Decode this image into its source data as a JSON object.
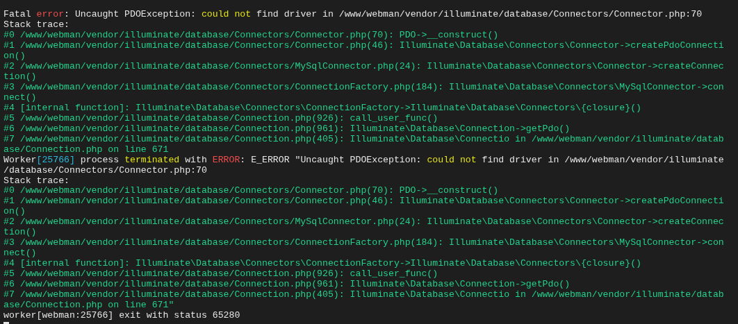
{
  "terminal": {
    "lines": [
      [
        {
          "text": "Fatal ",
          "color": "#e6e6e6"
        },
        {
          "text": "error",
          "color": "#f14c4c"
        },
        {
          "text": ": Uncaught PDOException: ",
          "color": "#e6e6e6"
        },
        {
          "text": "could not",
          "color": "#e5e510"
        },
        {
          "text": " find driver in /www/webman/vendor/illuminate/database/Connectors/Connector.php:70",
          "color": "#e6e6e6"
        }
      ],
      [
        {
          "text": "Stack trace:",
          "color": "#e6e6e6"
        }
      ],
      [
        {
          "text": "#0 /www/webman/vendor/illuminate/database/Connectors/Connector.php(70): PDO->__construct()",
          "color": "#23d18b"
        }
      ],
      [
        {
          "text": "#1 /www/webman/vendor/illuminate/database/Connectors/Connector.php(46): Illuminate\\Database\\Connectors\\Connector->createPdoConnecti",
          "color": "#23d18b"
        }
      ],
      [
        {
          "text": "on()",
          "color": "#23d18b"
        }
      ],
      [
        {
          "text": "#2 /www/webman/vendor/illuminate/database/Connectors/MySqlConnector.php(24): Illuminate\\Database\\Connectors\\Connector->createConnec",
          "color": "#23d18b"
        }
      ],
      [
        {
          "text": "tion()",
          "color": "#23d18b"
        }
      ],
      [
        {
          "text": "#3 /www/webman/vendor/illuminate/database/Connectors/ConnectionFactory.php(184): Illuminate\\Database\\Connectors\\MySqlConnector->con",
          "color": "#23d18b"
        }
      ],
      [
        {
          "text": "nect()",
          "color": "#23d18b"
        }
      ],
      [
        {
          "text": "#4 [internal function]: Illuminate\\Database\\Connectors\\ConnectionFactory->Illuminate\\Database\\Connectors\\{closure}()",
          "color": "#23d18b"
        }
      ],
      [
        {
          "text": "#5 /www/webman/vendor/illuminate/database/Connection.php(926): call_user_func()",
          "color": "#23d18b"
        }
      ],
      [
        {
          "text": "#6 /www/webman/vendor/illuminate/database/Connection.php(961): Illuminate\\Database\\Connection->getPdo()",
          "color": "#23d18b"
        }
      ],
      [
        {
          "text": "#7 /www/webman/vendor/illuminate/database/Connection.php(405): Illuminate\\Database\\Connectio in /www/webman/vendor/illuminate/datab",
          "color": "#23d18b"
        }
      ],
      [
        {
          "text": "ase/Connection.php on line 671",
          "color": "#23d18b"
        }
      ],
      [
        {
          "text": "Worker",
          "color": "#e6e6e6"
        },
        {
          "text": "[25766]",
          "color": "#29b8db"
        },
        {
          "text": " process ",
          "color": "#e6e6e6"
        },
        {
          "text": "terminated",
          "color": "#e5e510"
        },
        {
          "text": " with ",
          "color": "#e6e6e6"
        },
        {
          "text": "ERROR",
          "color": "#f14c4c"
        },
        {
          "text": ": E_ERROR \"Uncaught PDOException: ",
          "color": "#e6e6e6"
        },
        {
          "text": "could not",
          "color": "#e5e510"
        },
        {
          "text": " find driver in /www/webman/vendor/illuminate",
          "color": "#e6e6e6"
        }
      ],
      [
        {
          "text": "/database/Connectors/Connector.php:70",
          "color": "#e6e6e6"
        }
      ],
      [
        {
          "text": "Stack trace:",
          "color": "#e6e6e6"
        }
      ],
      [
        {
          "text": "#0 /www/webman/vendor/illuminate/database/Connectors/Connector.php(70): PDO->__construct()",
          "color": "#23d18b"
        }
      ],
      [
        {
          "text": "#1 /www/webman/vendor/illuminate/database/Connectors/Connector.php(46): Illuminate\\Database\\Connectors\\Connector->createPdoConnecti",
          "color": "#23d18b"
        }
      ],
      [
        {
          "text": "on()",
          "color": "#23d18b"
        }
      ],
      [
        {
          "text": "#2 /www/webman/vendor/illuminate/database/Connectors/MySqlConnector.php(24): Illuminate\\Database\\Connectors\\Connector->createConnec",
          "color": "#23d18b"
        }
      ],
      [
        {
          "text": "tion()",
          "color": "#23d18b"
        }
      ],
      [
        {
          "text": "#3 /www/webman/vendor/illuminate/database/Connectors/ConnectionFactory.php(184): Illuminate\\Database\\Connectors\\MySqlConnector->con",
          "color": "#23d18b"
        }
      ],
      [
        {
          "text": "nect()",
          "color": "#23d18b"
        }
      ],
      [
        {
          "text": "#4 [internal function]: Illuminate\\Database\\Connectors\\ConnectionFactory->Illuminate\\Database\\Connectors\\{closure}()",
          "color": "#23d18b"
        }
      ],
      [
        {
          "text": "#5 /www/webman/vendor/illuminate/database/Connection.php(926): call_user_func()",
          "color": "#23d18b"
        }
      ],
      [
        {
          "text": "#6 /www/webman/vendor/illuminate/database/Connection.php(961): Illuminate\\Database\\Connection->getPdo()",
          "color": "#23d18b"
        }
      ],
      [
        {
          "text": "#7 /www/webman/vendor/illuminate/database/Connection.php(405): Illuminate\\Database\\Connectio in /www/webman/vendor/illuminate/datab",
          "color": "#23d18b"
        }
      ],
      [
        {
          "text": "ase/Connection.php on line 671\"",
          "color": "#23d18b"
        }
      ],
      [
        {
          "text": "worker[webman:25766] exit with status 65280",
          "color": "#e6e6e6"
        }
      ]
    ]
  }
}
